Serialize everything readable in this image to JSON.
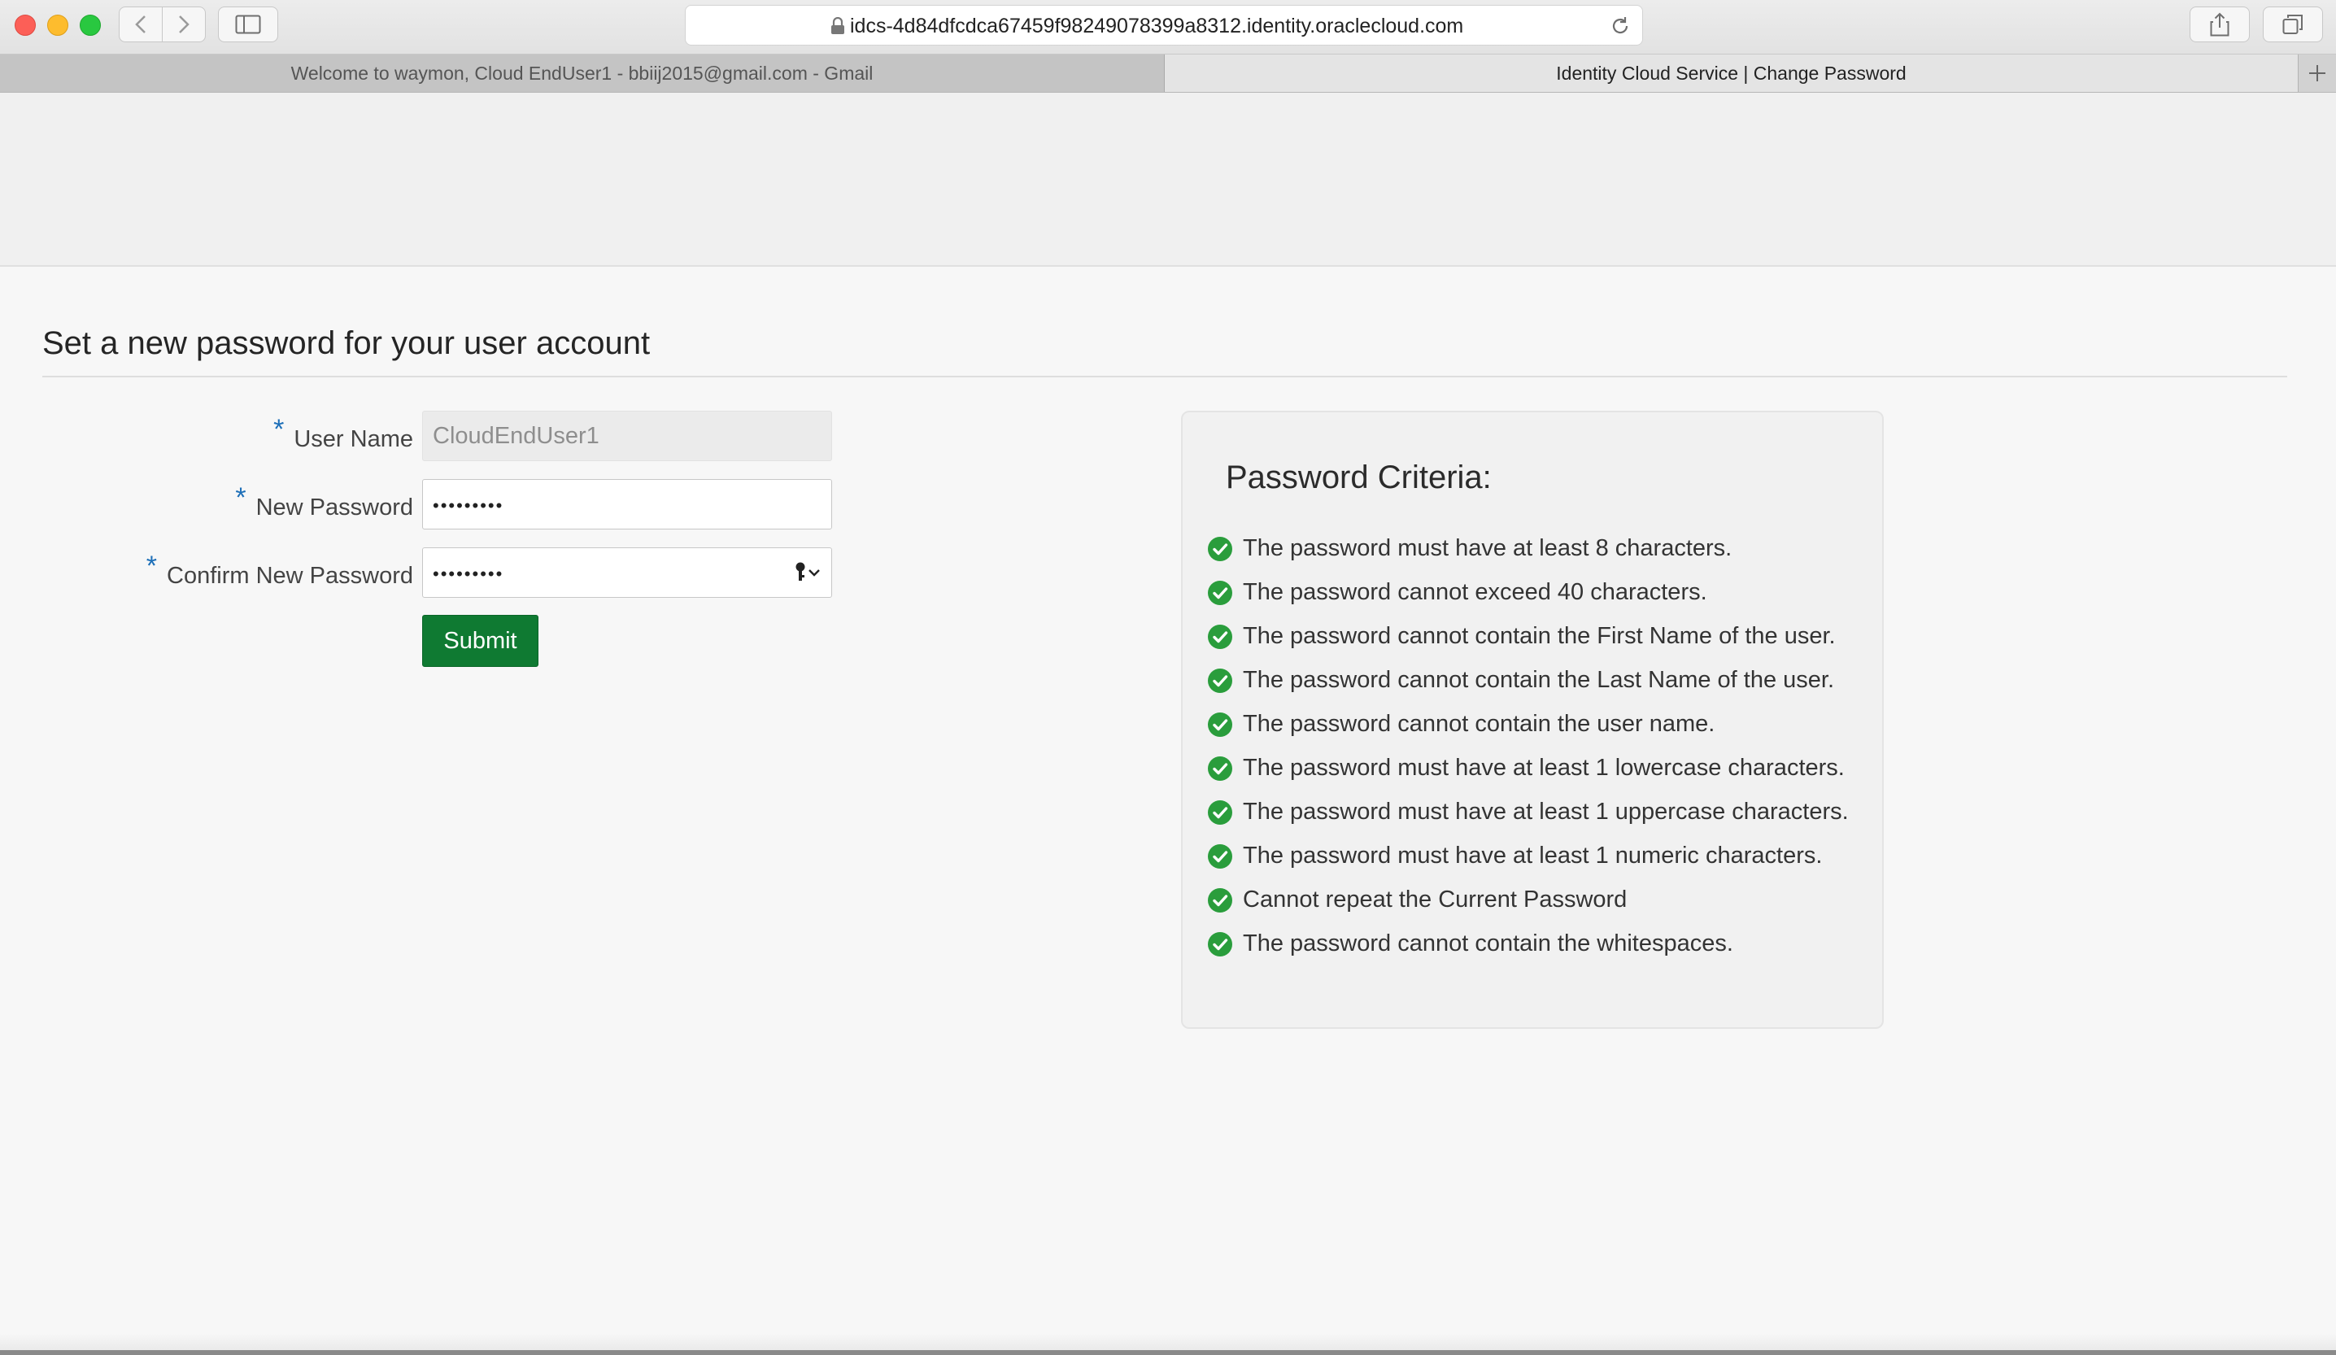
{
  "browser": {
    "url": "idcs-4d84dfcdca67459f98249078399a8312.identity.oraclecloud.com",
    "tabs": [
      {
        "label": "Welcome to waymon, Cloud EndUser1 - bbiij2015@gmail.com - Gmail",
        "active": false
      },
      {
        "label": "Identity Cloud Service | Change Password",
        "active": true
      }
    ]
  },
  "page": {
    "title": "Set a new password for your user account"
  },
  "form": {
    "required_marker": "*",
    "username": {
      "label": "User Name",
      "value": "CloudEndUser1"
    },
    "new_password": {
      "label": "New Password",
      "masked_value": "•••••••••"
    },
    "confirm_password": {
      "label": "Confirm New Password",
      "masked_value": "•••••••••"
    },
    "submit_label": "Submit"
  },
  "criteria": {
    "heading": "Password Criteria:",
    "status_color": "#2a9d3c",
    "items": [
      {
        "text": "The password must have at least 8 characters.",
        "met": true
      },
      {
        "text": "The password cannot exceed 40 characters.",
        "met": true
      },
      {
        "text": "The password cannot contain the First Name of the user.",
        "met": true
      },
      {
        "text": "The password cannot contain the Last Name of the user.",
        "met": true
      },
      {
        "text": "The password cannot contain the user name.",
        "met": true
      },
      {
        "text": "The password must have at least 1 lowercase characters.",
        "met": true
      },
      {
        "text": "The password must have at least 1 uppercase characters.",
        "met": true
      },
      {
        "text": "The password must have at least 1 numeric characters.",
        "met": true
      },
      {
        "text": "Cannot repeat the Current Password",
        "met": true
      },
      {
        "text": "The password cannot contain the whitespaces.",
        "met": true
      }
    ]
  }
}
